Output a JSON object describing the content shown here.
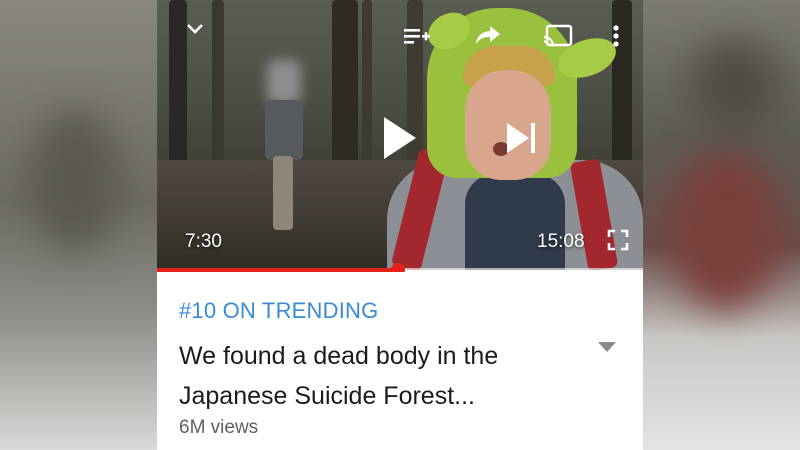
{
  "video": {
    "current_time": "7:30",
    "duration": "15:08",
    "progress": 0.496
  },
  "icons": {
    "collapse": "chevron-down-icon",
    "add_to_queue": "add-to-queue-icon",
    "share": "share-icon",
    "cast": "cast-icon",
    "more": "more-vert-icon",
    "play": "play-icon",
    "next": "skip-next-icon",
    "fullscreen": "fullscreen-icon",
    "expand_description": "expand-caret-icon"
  },
  "info": {
    "trending": "#10 ON TRENDING",
    "title_line1": "We found a dead body in the",
    "title_line2": "Japanese Suicide Forest...",
    "views": "6M views"
  },
  "colors": {
    "accent_progress": "#e62117",
    "trending_text": "#3a8bd6"
  }
}
